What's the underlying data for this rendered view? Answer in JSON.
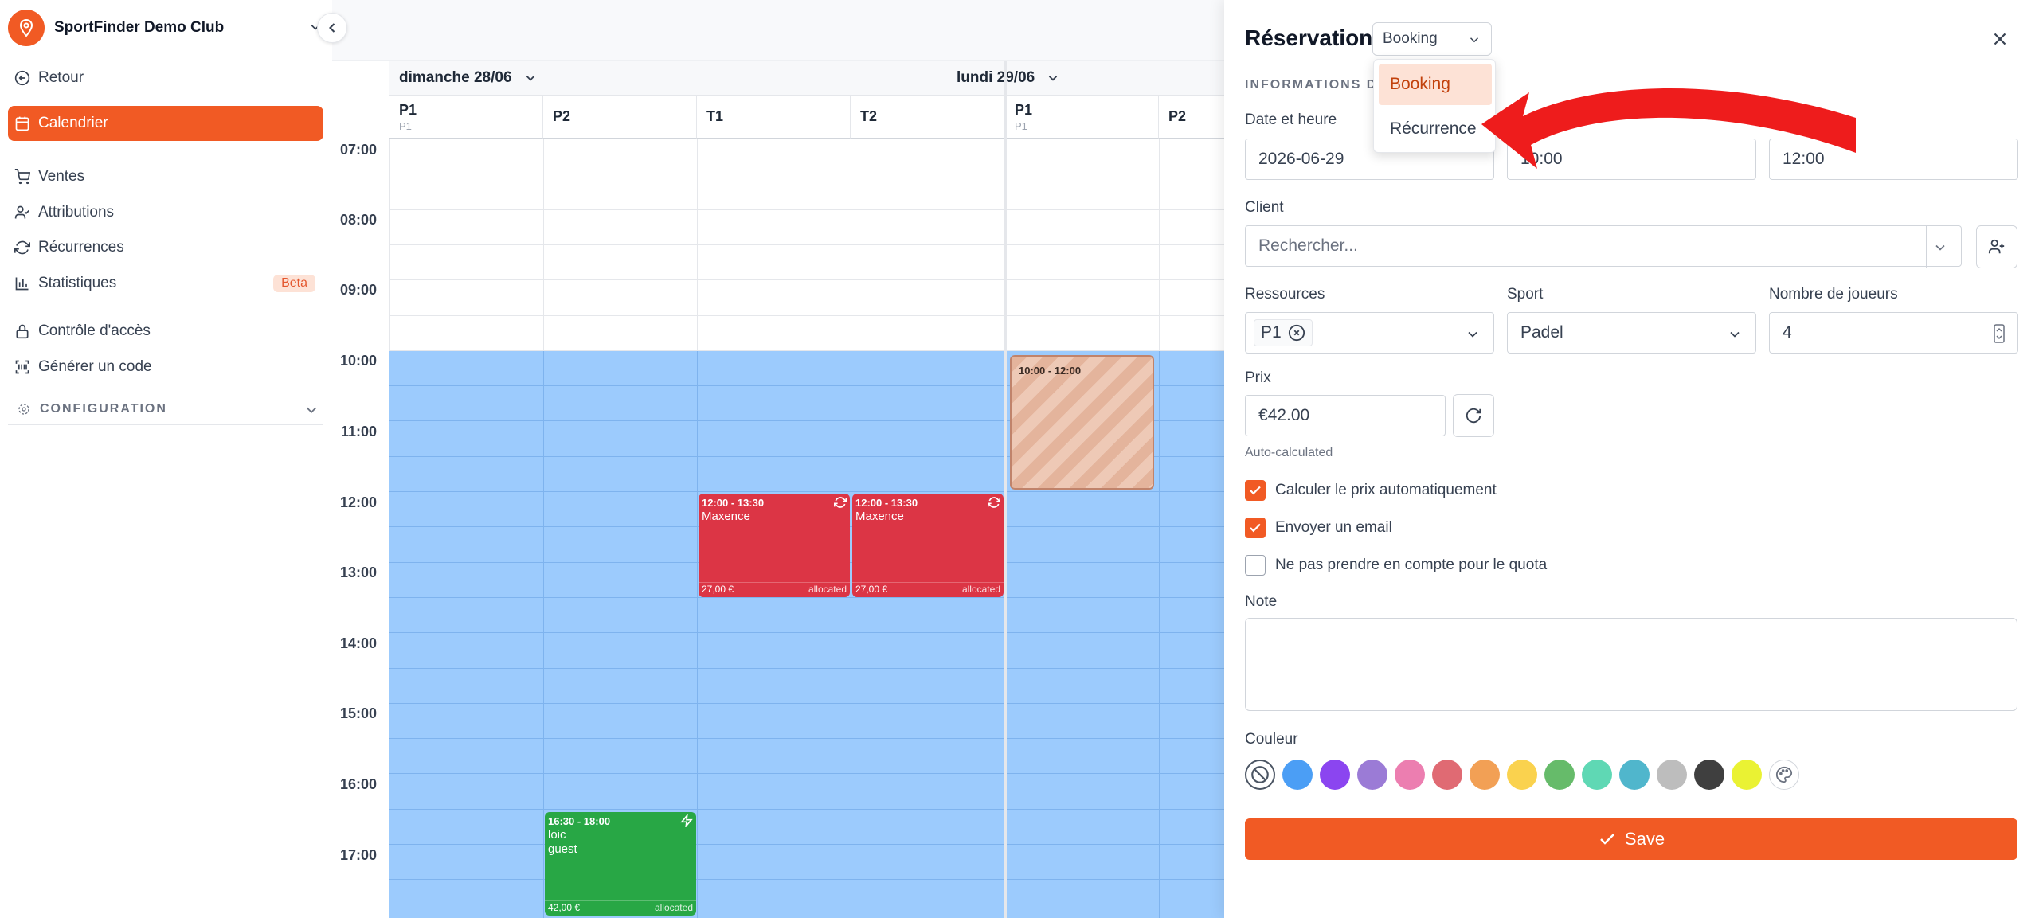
{
  "sidebar": {
    "club_name": "SportFinder Demo Club",
    "back_label": "Retour",
    "items": [
      {
        "label": "Calendrier",
        "icon": "calendar-icon",
        "active": true
      },
      {
        "label": "Ventes",
        "icon": "cart-icon"
      },
      {
        "label": "Attributions",
        "icon": "user-check-icon"
      },
      {
        "label": "Récurrences",
        "icon": "refresh-icon"
      },
      {
        "label": "Statistiques",
        "icon": "bar-chart-icon",
        "badge": "Beta"
      },
      {
        "label": "Contrôle d'accès",
        "icon": "lock-icon"
      },
      {
        "label": "Générer un code",
        "icon": "qr-code-icon"
      }
    ],
    "config_label": "CONFIGURATION",
    "colors": {
      "accent": "#f15a24"
    }
  },
  "calendar": {
    "days": [
      {
        "label": "dimanche 28/06"
      },
      {
        "label": "lundi 29/06"
      }
    ],
    "resources_day1": [
      {
        "name": "P1",
        "sub": "P1"
      },
      {
        "name": "P2",
        "sub": ""
      },
      {
        "name": "T1",
        "sub": ""
      },
      {
        "name": "T2",
        "sub": ""
      }
    ],
    "resources_day2": [
      {
        "name": "P1",
        "sub": "P1"
      },
      {
        "name": "P2",
        "sub": ""
      }
    ],
    "times": [
      "07:00",
      "08:00",
      "09:00",
      "10:00",
      "11:00",
      "12:00",
      "13:00",
      "14:00",
      "15:00",
      "16:00",
      "17:00"
    ],
    "events": [
      {
        "time": "12:00 - 13:30",
        "name": "Maxence",
        "price": "27,00 €",
        "status": "allocated",
        "color": "#dc3545",
        "icon": "recurring-icon"
      },
      {
        "time": "12:00 - 13:30",
        "name": "Maxence",
        "price": "27,00 €",
        "status": "allocated",
        "color": "#dc3545",
        "icon": "recurring-icon"
      },
      {
        "time": "16:30 - 18:00",
        "name": "loic",
        "name2": "guest",
        "price": "42,00 €",
        "status": "allocated",
        "color": "#28a745",
        "icon": "lightning-icon"
      },
      {
        "time": "10:00 - 12:00",
        "pending": true
      }
    ]
  },
  "panel": {
    "title": "Réservation",
    "type_value": "Booking",
    "type_options": [
      "Booking",
      "Récurrence"
    ],
    "section": "INFORMATIONS DE",
    "date_label": "Date et heure",
    "date": "2026-06-29",
    "start": "10:00",
    "end": "12:00",
    "client_label": "Client",
    "client_placeholder": "Rechercher...",
    "resources_label": "Ressources",
    "resource_chip": "P1",
    "sport_label": "Sport",
    "sport": "Padel",
    "players_label": "Nombre de joueurs",
    "players": "4",
    "price_label": "Prix",
    "price": "€42.00",
    "price_hint": "Auto-calculated",
    "checks": [
      {
        "label": "Calculer le prix automatiquement",
        "checked": true
      },
      {
        "label": "Envoyer un email",
        "checked": true
      },
      {
        "label": "Ne pas prendre en compte pour le quota",
        "checked": false
      }
    ],
    "note_label": "Note",
    "color_label": "Couleur",
    "swatches": [
      "#4b9ef5",
      "#8b45f0",
      "#9b7bd6",
      "#ec7eb0",
      "#e06a73",
      "#f2a055",
      "#fad24e",
      "#66bb6a",
      "#5fd8b4",
      "#50b6cc",
      "#bdbdbd",
      "#3f3f3f",
      "#eaf233"
    ],
    "save_label": "Save"
  }
}
